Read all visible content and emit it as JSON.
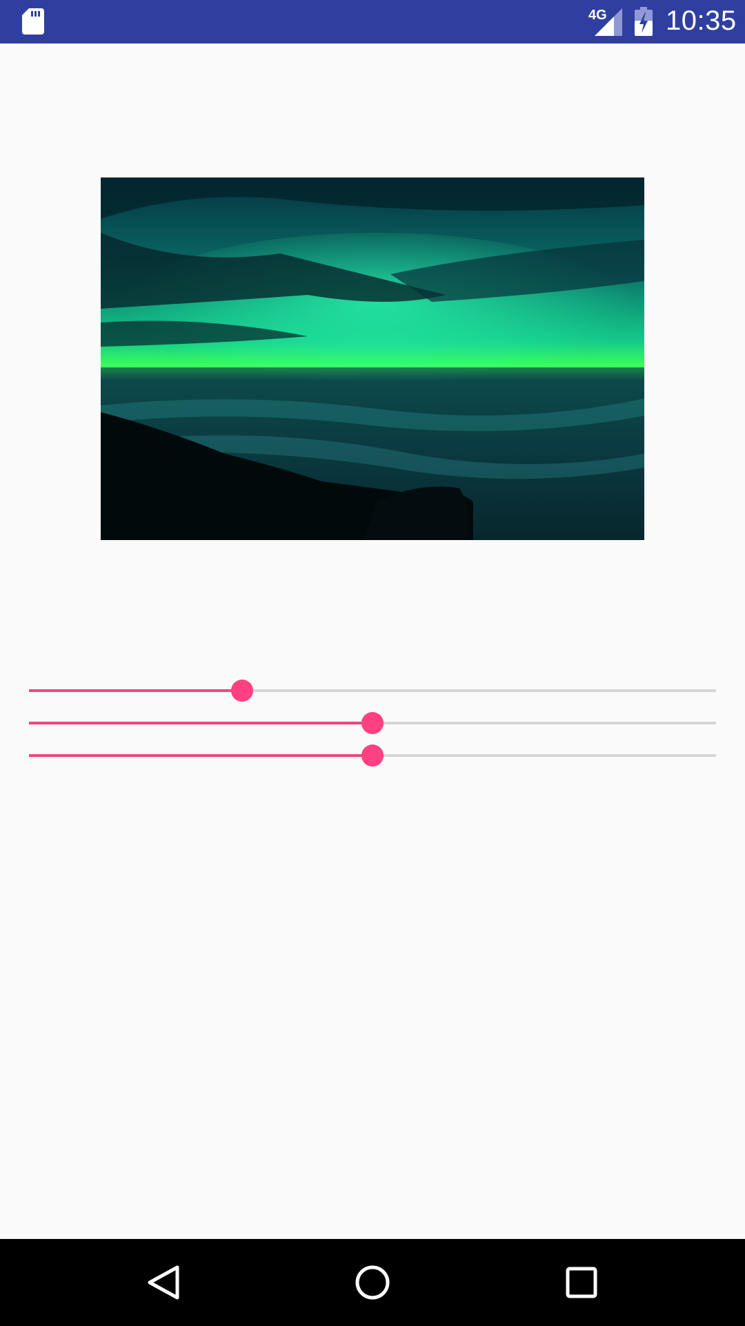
{
  "status_bar": {
    "network_type": "4G",
    "time": "10:35",
    "icons": [
      "sd-card-icon",
      "signal-icon",
      "battery-charging-icon"
    ],
    "color": "#303f9f"
  },
  "image": {
    "description_icon": "sunset-ocean-photo"
  },
  "sliders": [
    {
      "name": "slider-1",
      "value": 0.31
    },
    {
      "name": "slider-2",
      "value": 0.5
    },
    {
      "name": "slider-3",
      "value": 0.5
    }
  ],
  "accent_color": "#ff4081",
  "nav_bar": {
    "buttons": [
      "back-icon",
      "home-icon",
      "recents-icon"
    ]
  }
}
